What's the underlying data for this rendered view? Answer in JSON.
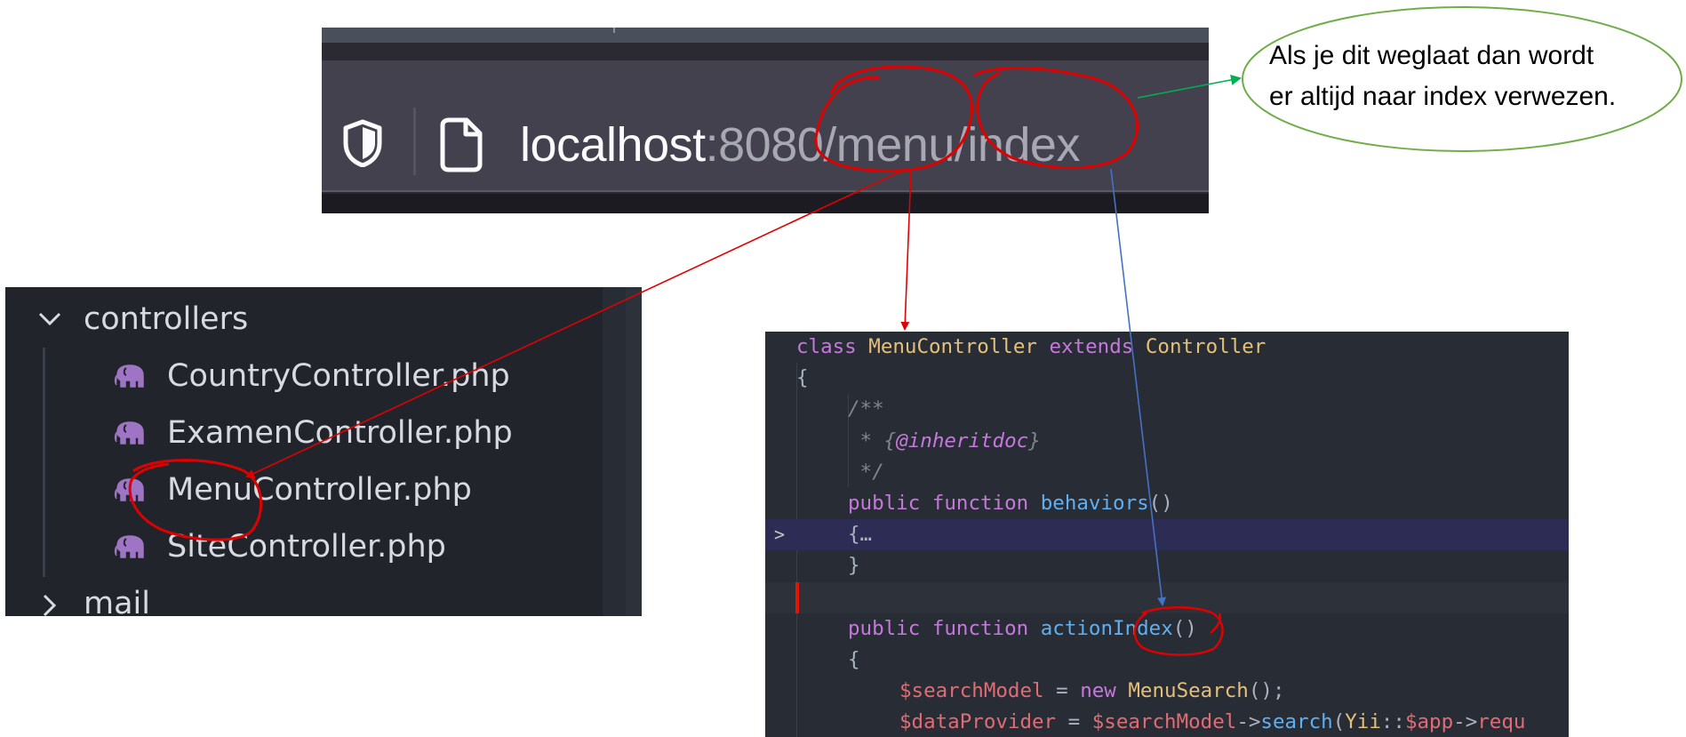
{
  "browser": {
    "url_host": "localhost",
    "url_rest": ":8080/menu/index",
    "icons": [
      "shield-icon",
      "page-icon"
    ],
    "colors": {
      "background": "#42414d",
      "host_text": "#fbfbfe",
      "path_text": "#a8a8b3"
    }
  },
  "callout": {
    "line1": "Als je dit weglaat dan wordt",
    "line2": "er altijd naar index verwezen."
  },
  "explorer": {
    "folder": "controllers",
    "files": [
      "CountryController.php",
      "ExamenController.php",
      "MenuController.php",
      "SiteController.php"
    ],
    "next_folder": "mail",
    "icons": [
      "chevron-down-icon",
      "php-elephant-icon",
      "chevron-right-icon"
    ]
  },
  "code": {
    "lines": [
      {
        "indent": 0,
        "tokens": [
          [
            "kw",
            "class "
          ],
          [
            "cls",
            "MenuController "
          ],
          [
            "kw",
            "extends "
          ],
          [
            "cls",
            "Controller"
          ]
        ]
      },
      {
        "indent": 0,
        "tokens": [
          [
            "pl",
            "{"
          ]
        ]
      },
      {
        "indent": 1,
        "tokens": [
          [
            "cm",
            "/**"
          ]
        ]
      },
      {
        "indent": 1,
        "tokens": [
          [
            "cm",
            " * {"
          ],
          [
            "tag",
            "@inheritdoc"
          ],
          [
            "cm",
            "}"
          ]
        ]
      },
      {
        "indent": 1,
        "tokens": [
          [
            "cm",
            " */"
          ]
        ]
      },
      {
        "indent": 1,
        "tokens": [
          [
            "kw",
            "public "
          ],
          [
            "kw",
            "function "
          ],
          [
            "fn",
            "behaviors"
          ],
          [
            "pl",
            "()"
          ]
        ]
      },
      {
        "indent": 1,
        "tokens": [
          [
            "pl",
            "{"
          ],
          [
            "pl",
            "…"
          ]
        ],
        "folded": true
      },
      {
        "indent": 1,
        "tokens": [
          [
            "pl",
            "}"
          ]
        ]
      },
      {
        "indent": 0,
        "tokens": [],
        "current": true
      },
      {
        "indent": 1,
        "tokens": [
          [
            "kw",
            "public "
          ],
          [
            "kw",
            "function "
          ],
          [
            "fn",
            "actionIndex"
          ],
          [
            "pl",
            "()"
          ]
        ]
      },
      {
        "indent": 1,
        "tokens": [
          [
            "pl",
            "{"
          ]
        ]
      },
      {
        "indent": 2,
        "tokens": [
          [
            "var",
            "$searchModel "
          ],
          [
            "pl",
            "= "
          ],
          [
            "kw",
            "new "
          ],
          [
            "cls",
            "MenuSearch"
          ],
          [
            "pl",
            "();"
          ]
        ]
      },
      {
        "indent": 2,
        "tokens": [
          [
            "var",
            "$dataProvider "
          ],
          [
            "pl",
            "= "
          ],
          [
            "var",
            "$searchModel"
          ],
          [
            "pl",
            "->"
          ],
          [
            "fn",
            "search"
          ],
          [
            "pl",
            "("
          ],
          [
            "cls",
            "Yii"
          ],
          [
            "pl",
            "::"
          ],
          [
            "var",
            "$app"
          ],
          [
            "pl",
            "->"
          ],
          [
            "var",
            "requ"
          ]
        ]
      }
    ],
    "colors": {
      "background": "#282c34",
      "keyword": "#c678dd",
      "class": "#e5c07b",
      "function": "#61afef",
      "variable": "#e06c75",
      "comment": "#7f848e"
    }
  },
  "annotations": {
    "colors": {
      "circle": "#e00000",
      "arrow_red": "#e00000",
      "arrow_blue": "#4472c4",
      "arrow_green": "#00b050",
      "callout_border": "#70ad47"
    }
  }
}
